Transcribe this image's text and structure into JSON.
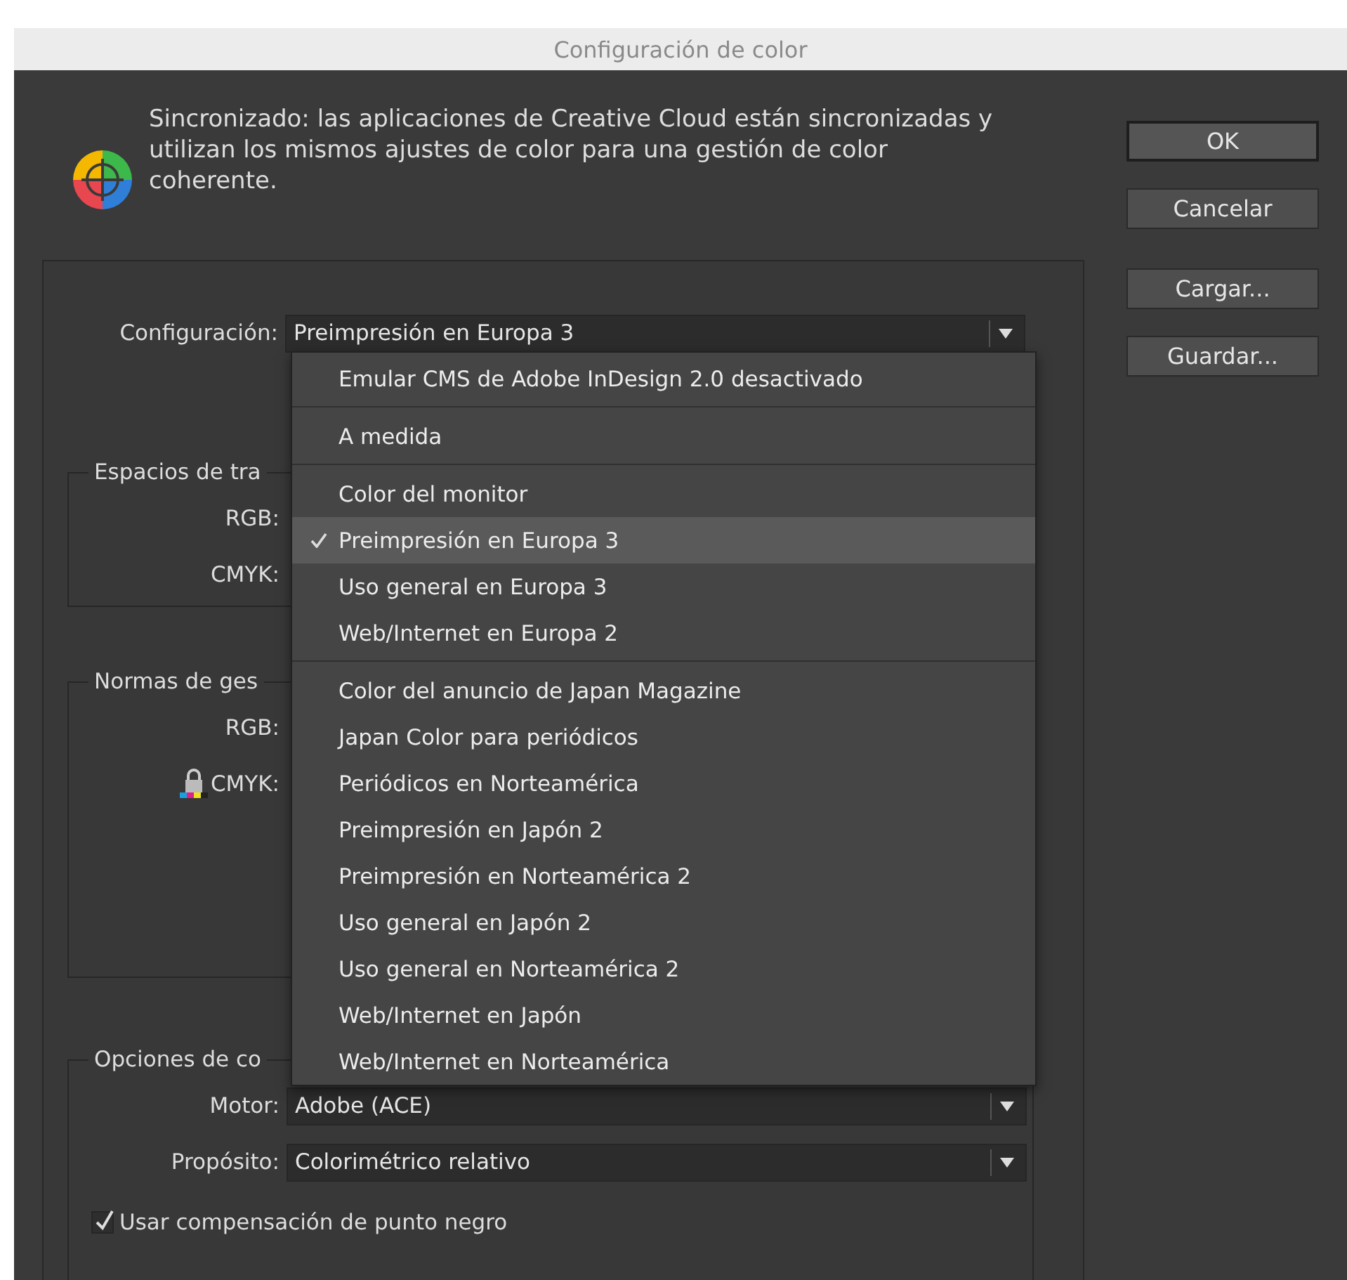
{
  "window": {
    "title": "Configuración de color"
  },
  "sync_message": "Sincronizado: las aplicaciones de Creative Cloud están sincronizadas y utilizan los mismos ajustes de color para una gestión de color coherente.",
  "buttons": [
    {
      "label": "OK",
      "default": true
    },
    {
      "label": "Cancelar",
      "default": false
    },
    {
      "label": "Cargar...",
      "default": false
    },
    {
      "label": "Guardar...",
      "default": false
    }
  ],
  "settings": {
    "label": "Configuración:",
    "value": "Preimpresión en Europa 3"
  },
  "settings_menu": {
    "groups": [
      [
        {
          "label": "Emular CMS de Adobe InDesign 2.0 desactivado",
          "selected": false
        }
      ],
      [
        {
          "label": "A medida",
          "selected": false
        }
      ],
      [
        {
          "label": "Color del monitor",
          "selected": false
        },
        {
          "label": "Preimpresión en Europa 3",
          "selected": true
        },
        {
          "label": "Uso general en Europa 3",
          "selected": false
        },
        {
          "label": "Web/Internet en Europa 2",
          "selected": false
        }
      ],
      [
        {
          "label": "Color del anuncio de Japan Magazine",
          "selected": false
        },
        {
          "label": "Japan Color para periódicos",
          "selected": false
        },
        {
          "label": "Periódicos en Norteamérica",
          "selected": false
        },
        {
          "label": "Preimpresión en Japón 2",
          "selected": false
        },
        {
          "label": "Preimpresión en Norteamérica 2",
          "selected": false
        },
        {
          "label": "Uso general en Japón 2",
          "selected": false
        },
        {
          "label": "Uso general en Norteamérica 2",
          "selected": false
        },
        {
          "label": "Web/Internet en Japón",
          "selected": false
        },
        {
          "label": "Web/Internet en Norteamérica",
          "selected": false
        }
      ]
    ]
  },
  "groups": [
    {
      "title": "Espacios de tra",
      "fields": [
        {
          "label": "RGB:"
        },
        {
          "label": "CMYK:"
        }
      ]
    },
    {
      "title": "Normas de ges",
      "fields": [
        {
          "label": "RGB:"
        },
        {
          "label": "CMYK:",
          "locked": true
        }
      ]
    },
    {
      "title": "Opciones de co",
      "fields": [
        {
          "label": "Motor:",
          "value": "Adobe (ACE)"
        },
        {
          "label": "Propósito:",
          "value": "Colorimétrico relativo"
        }
      ],
      "checkbox": {
        "label": "Usar compensación de punto negro",
        "checked": true
      }
    }
  ]
}
